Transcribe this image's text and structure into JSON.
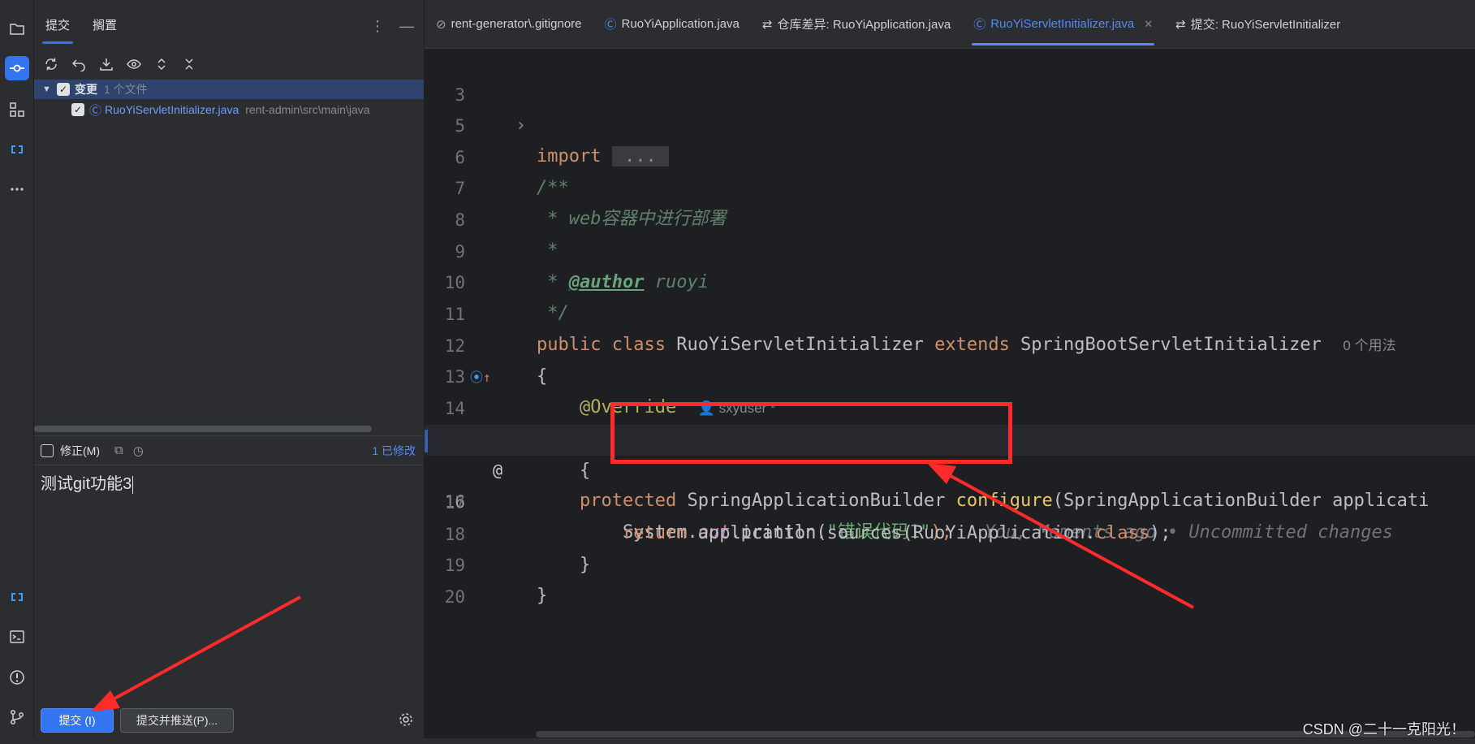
{
  "sidebar": {
    "tools_top": [
      "project-icon",
      "commit-icon",
      "structure-icon",
      "link-icon",
      "more-icon"
    ],
    "tools_bottom": [
      "link-icon",
      "terminal-icon",
      "problems-icon",
      "git-icon"
    ]
  },
  "commit_panel": {
    "tabs": [
      {
        "label": "提交",
        "active": true
      },
      {
        "label": "搁置",
        "active": false
      }
    ],
    "changes_group": {
      "label": "变更",
      "count": "1 个文件"
    },
    "files": [
      {
        "name": "RuoYiServletInitializer.java",
        "path": "rent-admin\\src\\main\\java"
      }
    ],
    "amend_label": "修正(M)",
    "modified_count": "1 已修改",
    "commit_message": "测试git功能3",
    "commit_button": "提交 (I)",
    "commit_push_button": "提交并推送(P)..."
  },
  "editor": {
    "tabs": [
      {
        "label": "rent-generator\\.gitignore",
        "icon": "ignore-icon",
        "active": false
      },
      {
        "label": "RuoYiApplication.java",
        "icon": "class-icon",
        "active": false
      },
      {
        "label": "仓库差异: RuoYiApplication.java",
        "icon": "diff-icon",
        "active": false
      },
      {
        "label": "RuoYiServletInitializer.java",
        "icon": "class-icon",
        "active": true
      },
      {
        "label": "提交: RuoYiServletInitializer",
        "icon": "diff-icon",
        "active": false
      }
    ],
    "lines": {
      "l3": {
        "num": "3",
        "kw": "import",
        "fold": " ... "
      },
      "l5": {
        "num": "5"
      },
      "l6": {
        "num": "6",
        "text": "/**"
      },
      "l7": {
        "num": "7",
        "text": " * web容器中进行部署"
      },
      "l8": {
        "num": "8",
        "text": " *"
      },
      "l9": {
        "num": "9",
        "pre": " * ",
        "tag": "@author",
        "post": " ruoyi"
      },
      "l10": {
        "num": "10",
        "text": " */"
      },
      "l11": {
        "num": "11",
        "kw1": "public class",
        "cls": " RuoYiServletInitializer ",
        "kw2": "extends",
        "base": " SpringBootServletInitializer",
        "hint": "0 个用法"
      },
      "l12": {
        "num": "12",
        "text": "{"
      },
      "l13": {
        "num": "13",
        "annotation": "@Override",
        "author": "sxyuser *"
      },
      "l14": {
        "num": "14",
        "kw": "protected",
        "ret": " SpringApplicationBuilder ",
        "method": "configure",
        "params": "(SpringApplicationBuilder applicati"
      },
      "l15": {
        "num": "15",
        "text": "{"
      },
      "l16": {
        "num": "16",
        "obj": "System.",
        "field": "out",
        "call": ".println(",
        "str": "\"错误代码1\"",
        "close": ");",
        "blame": "You, Moments ago • Uncommitted changes"
      },
      "l17": {
        "num": "17",
        "kw": "return",
        "pre": " application.sources(RuoYiApplication.",
        "kw2": "class",
        "post": ");"
      },
      "l18": {
        "num": "18",
        "text": "}"
      },
      "l19": {
        "num": "19",
        "text": "}"
      },
      "l20": {
        "num": "20"
      }
    }
  },
  "watermark": "CSDN @二十一克阳光！",
  "colors": {
    "accent": "#3574f0",
    "annotation_red": "#ff2a2a"
  }
}
